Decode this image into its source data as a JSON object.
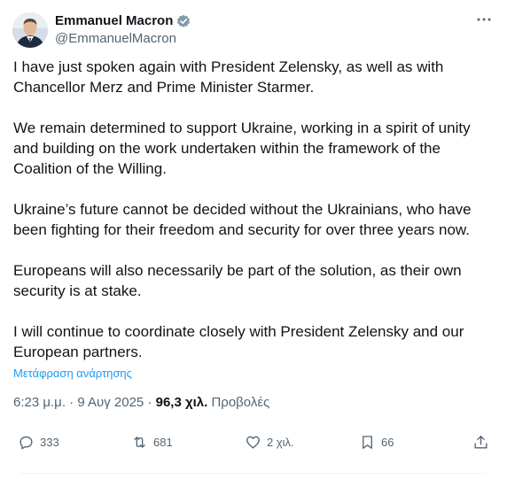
{
  "author": {
    "display_name": "Emmanuel Macron",
    "handle": "@EmmanuelMacron"
  },
  "tweet": {
    "paragraphs": [
      "I have just spoken again with President Zelensky, as well as with Chancellor Merz and Prime Minister Starmer.",
      "We remain determined to support Ukraine, working in a spirit of unity and building on the work undertaken within the framework of the Coalition of the Willing.",
      "Ukraine’s future cannot be decided without the Ukrainians, who have been fighting for their freedom and security for over three years now.",
      "Europeans will also necessarily be part of the solution, as their own security is at stake.",
      "I will continue to coordinate closely with President Zelensky and our European partners."
    ],
    "translate_link": "Μετάφραση ανάρτησης",
    "time": "6:23 μ.μ.",
    "date": "9 Αυγ 2025",
    "separator": "·",
    "views_count": "96,3 χιλ.",
    "views_label": "Προβολές"
  },
  "actions": {
    "replies": "333",
    "reposts": "681",
    "likes": "2 χιλ.",
    "bookmarks": "66"
  },
  "colors": {
    "accent": "#1d9bf0",
    "secondary_text": "#536471",
    "primary_text": "#0f1419"
  }
}
